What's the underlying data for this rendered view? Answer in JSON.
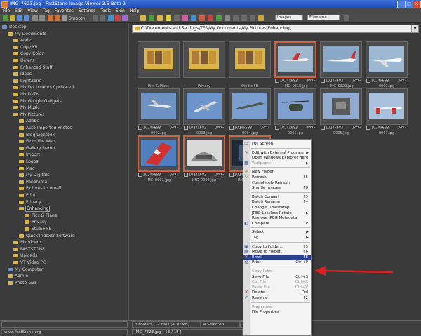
{
  "window": {
    "title": "IMG_7623.jpg - FastStone Image Viewer 3.5 Beta 2"
  },
  "menu": [
    "File",
    "Edit",
    "View",
    "Tag",
    "Favorites",
    "Settings",
    "Tools",
    "Skin",
    "Help"
  ],
  "toolbar": {
    "smooth_label": "Smooth"
  },
  "viewbar": {
    "view_combo": "Images",
    "sort_combo": "Filename"
  },
  "path": {
    "value": "C:\\Documents and Settings\\TFS\\My Documents\\My Pictures\\Enhancing\\"
  },
  "tree": [
    {
      "label": "Desktop",
      "depth": 0
    },
    {
      "label": "My Documents",
      "depth": 1
    },
    {
      "label": "Audio",
      "depth": 2
    },
    {
      "label": "Copy Kit",
      "depth": 2
    },
    {
      "label": "Copy Color",
      "depth": 2
    },
    {
      "label": "Downs",
      "depth": 2
    },
    {
      "label": "Enhanced Stuff",
      "depth": 2
    },
    {
      "label": "Ideas",
      "depth": 2
    },
    {
      "label": "LightZone",
      "depth": 2
    },
    {
      "label": "My Documents ( private )",
      "depth": 2
    },
    {
      "label": "My DVDs",
      "depth": 2
    },
    {
      "label": "My Google Gadgets",
      "depth": 2
    },
    {
      "label": "My Music",
      "depth": 2
    },
    {
      "label": "My Pictures",
      "depth": 2
    },
    {
      "label": "Adobe",
      "depth": 3
    },
    {
      "label": "Auto Imported Photos",
      "depth": 3
    },
    {
      "label": "Blog Lightbox",
      "depth": 3
    },
    {
      "label": "From the Web",
      "depth": 3
    },
    {
      "label": "Gallery Demo",
      "depth": 3
    },
    {
      "label": "Import",
      "depth": 3
    },
    {
      "label": "Logos",
      "depth": 3
    },
    {
      "label": "Mac",
      "depth": 3
    },
    {
      "label": "My Digitals",
      "depth": 3
    },
    {
      "label": "Panorama",
      "depth": 3
    },
    {
      "label": "Pictures to email",
      "depth": 3
    },
    {
      "label": "Print",
      "depth": 3
    },
    {
      "label": "Privacy",
      "depth": 3
    },
    {
      "label": "Enhancing",
      "depth": 3,
      "selected": true
    },
    {
      "label": "Pics & Plans",
      "depth": 4
    },
    {
      "label": "Privacy",
      "depth": 4
    },
    {
      "label": "Studio FB",
      "depth": 4
    },
    {
      "label": "Quick Indexer Software",
      "depth": 3
    },
    {
      "label": "My Videos",
      "depth": 2
    },
    {
      "label": "FASTSTONE",
      "depth": 2
    },
    {
      "label": "Uploads",
      "depth": 2
    },
    {
      "label": "VT Video PC",
      "depth": 2
    },
    {
      "label": "My Computer",
      "depth": 1
    },
    {
      "label": "Admin",
      "depth": 1
    },
    {
      "label": "Photo-G3S",
      "depth": 1
    }
  ],
  "thumbnails": [
    {
      "info": "",
      "fmt": "",
      "name": "Pics & Plans",
      "kind": "folder"
    },
    {
      "info": "",
      "fmt": "",
      "name": "Privacy",
      "kind": "folder"
    },
    {
      "info": "",
      "fmt": "",
      "name": "Studio FB",
      "kind": "folder"
    },
    {
      "info": "1024x683",
      "fmt": "JPEG",
      "name": "_MG_0318.jpg",
      "kind": "plane-red",
      "selected": true
    },
    {
      "info": "1024x683",
      "fmt": "JPEG",
      "name": "_MG_0320.jpg",
      "kind": "plane-white"
    },
    {
      "info": "1024x683",
      "fmt": "JPEG",
      "name": "0001.jpg",
      "kind": "plane-white2"
    },
    {
      "info": "1024x683",
      "fmt": "JPEG",
      "name": "0002.jpg",
      "kind": "jet-blue"
    },
    {
      "info": "1024x683",
      "fmt": "JPEG",
      "name": "0003.jpg",
      "kind": "jet-blue2"
    },
    {
      "info": "1024x683",
      "fmt": "JPEG",
      "name": "0004.jpg",
      "kind": "jet-blue3"
    },
    {
      "info": "1024x683",
      "fmt": "JPEG",
      "name": "0005.jpg",
      "kind": "heli"
    },
    {
      "info": "1024x683",
      "fmt": "JPEG",
      "name": "0006.jpg",
      "kind": "heli2"
    },
    {
      "info": "1024x683",
      "fmt": "JPEG",
      "name": "0007.jpg",
      "kind": "plane-white3"
    },
    {
      "info": "1024x683",
      "fmt": "JPEG",
      "name": "IMG_0001.jpg",
      "kind": "tail",
      "selected": true
    },
    {
      "info": "1024x683",
      "fmt": "JPEG",
      "name": "IMG_0002.jpg",
      "kind": "cockpit",
      "selected": true
    },
    {
      "info": "1024x683",
      "fmt": "JPEG",
      "name": "IMG_7623.jpg",
      "kind": "dark",
      "selected": true
    }
  ],
  "context_menu": [
    {
      "label": "Full Screen",
      "shortcut": "",
      "icon": "monitor-icon",
      "state": "normal"
    },
    {
      "sep": true
    },
    {
      "label": "Edit with External Program",
      "shortcut": "",
      "arrow": true,
      "icon": "edit-icon",
      "state": "normal"
    },
    {
      "label": "Open Windows Explorer Here",
      "shortcut": "",
      "icon": "",
      "state": "normal"
    },
    {
      "label": "Wallpaper",
      "shortcut": "",
      "arrow": true,
      "icon": "wallpaper-icon",
      "state": "disabled"
    },
    {
      "sep": true
    },
    {
      "label": "New Folder",
      "shortcut": "",
      "icon": "new-folder-icon",
      "state": "normal"
    },
    {
      "label": "Refresh",
      "shortcut": "F5",
      "icon": "refresh-icon",
      "state": "normal"
    },
    {
      "label": "Completely Refresh",
      "shortcut": "",
      "icon": "",
      "state": "normal"
    },
    {
      "label": "Shuffle Images",
      "shortcut": "F8",
      "icon": "",
      "state": "normal"
    },
    {
      "sep": true
    },
    {
      "label": "Batch Convert",
      "shortcut": "F3",
      "icon": "",
      "state": "normal"
    },
    {
      "label": "Batch Rename",
      "shortcut": "F4",
      "icon": "",
      "state": "normal"
    },
    {
      "label": "Change Timestamp",
      "shortcut": "",
      "icon": "",
      "state": "normal"
    },
    {
      "label": "JPEG Lossless Rotate",
      "shortcut": "",
      "arrow": true,
      "icon": "",
      "state": "normal"
    },
    {
      "label": "Remove JPEG Metadata",
      "shortcut": "",
      "icon": "",
      "state": "normal"
    },
    {
      "label": "Compare",
      "shortcut": "P",
      "icon": "compare-icon",
      "state": "normal"
    },
    {
      "sep": true
    },
    {
      "label": "Select",
      "shortcut": "",
      "arrow": true,
      "icon": "",
      "state": "normal"
    },
    {
      "label": "Tag",
      "shortcut": "",
      "arrow": true,
      "icon": "",
      "state": "normal"
    },
    {
      "sep": true
    },
    {
      "label": "Copy to Folder...",
      "shortcut": "F5",
      "icon": "copy-folder-icon",
      "state": "normal"
    },
    {
      "label": "Move to Folder...",
      "shortcut": "F6",
      "icon": "move-folder-icon",
      "state": "normal"
    },
    {
      "label": "Email",
      "shortcut": "F8",
      "icon": "email-icon",
      "state": "highlighted"
    },
    {
      "label": "Print",
      "shortcut": "Ctrl+P",
      "icon": "print-icon",
      "state": "normal"
    },
    {
      "sep": true
    },
    {
      "label": "Copy Path",
      "shortcut": "",
      "icon": "",
      "state": "disabled"
    },
    {
      "label": "Save File",
      "shortcut": "Ctrl+S",
      "icon": "",
      "state": "normal"
    },
    {
      "label": "Cut File",
      "shortcut": "Ctrl+X",
      "icon": "",
      "state": "disabled"
    },
    {
      "label": "Paste File",
      "shortcut": "Ctrl+V",
      "icon": "",
      "state": "disabled"
    },
    {
      "label": "Delete",
      "shortcut": "Del",
      "icon": "delete-icon",
      "state": "normal"
    },
    {
      "label": "Rename",
      "shortcut": "F2",
      "icon": "rename-icon",
      "state": "normal"
    },
    {
      "sep": true
    },
    {
      "label": "Properties",
      "shortcut": "",
      "icon": "",
      "state": "disabled"
    },
    {
      "label": "File Properties",
      "shortcut": "",
      "icon": "",
      "state": "normal"
    }
  ],
  "status": {
    "site": "www.FastStone.org",
    "folders_files": "3 Folders, 12 Files (4.10 MB)",
    "selected": "4 Selected",
    "info": "IMG_7623.jpg [ 13 / 15 ]",
    "extra": "8 Se"
  },
  "colors": {
    "accent": "#2a3f8f",
    "selection": "#d9603d",
    "arrow": "#e02020"
  }
}
